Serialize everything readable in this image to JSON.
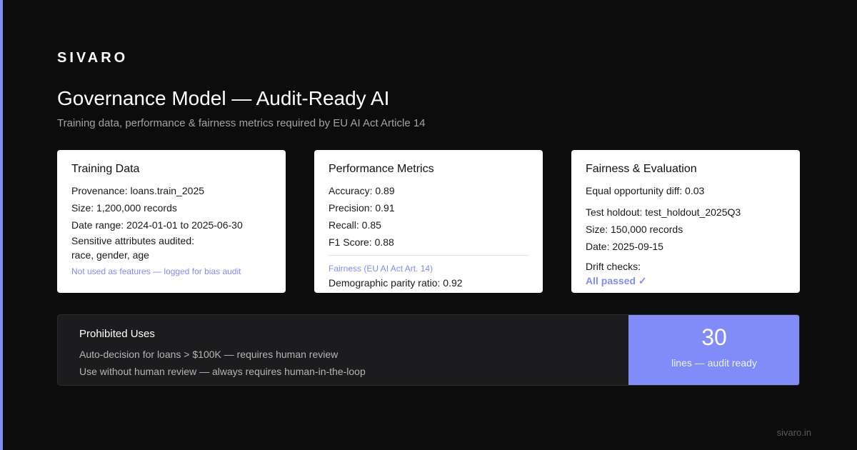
{
  "brand": "SIVARO",
  "title": "Governance Model — Audit-Ready AI",
  "subtitle": "Training data, performance & fairness metrics required by EU AI Act Article 14",
  "cards": {
    "training": {
      "title": "Training Data",
      "provenance": "Provenance: loans.train_2025",
      "size": "Size: 1,200,000 records",
      "date_range": "Date range: 2024-01-01 to 2025-06-30",
      "sensitive_label": "Sensitive attributes audited:",
      "sensitive_values": "race, gender, age",
      "note": "Not used as features — logged for bias audit"
    },
    "performance": {
      "title": "Performance Metrics",
      "accuracy": "Accuracy: 0.89",
      "precision": "Precision: 0.91",
      "recall": "Recall: 0.85",
      "f1": "F1 Score: 0.88",
      "fairness_label": "Fairness (EU AI Act Art. 14)",
      "parity": "Demographic parity ratio: 0.92"
    },
    "fairness": {
      "title": "Fairness & Evaluation",
      "equal_opportunity": "Equal opportunity diff: 0.03",
      "holdout": "Test holdout: test_holdout_2025Q3",
      "size": "Size: 150,000 records",
      "date": "Date: 2025-09-15",
      "drift_label": "Drift checks:",
      "drift_status": "All passed ✓"
    }
  },
  "prohibited": {
    "title": "Prohibited Uses",
    "items": [
      "Auto-decision for loans > $100K — requires human review",
      "Use without human review — always requires human-in-the-loop"
    ]
  },
  "stat": {
    "value": "30",
    "label": "lines — audit ready"
  },
  "footer_url": "sivaro.in",
  "colors": {
    "background": "#0c0c0c",
    "accent": "#818cf8",
    "card": "#ffffff",
    "panel": "#1c1c1e"
  }
}
